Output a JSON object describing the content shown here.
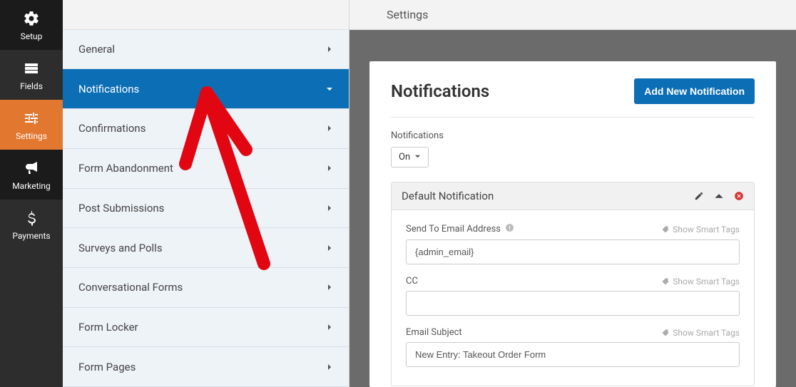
{
  "header": {
    "title": "Settings"
  },
  "nav": {
    "items": [
      {
        "label": "Setup",
        "icon": "gear-icon"
      },
      {
        "label": "Fields",
        "icon": "list-icon"
      },
      {
        "label": "Settings",
        "icon": "sliders-icon"
      },
      {
        "label": "Marketing",
        "icon": "bullhorn-icon"
      },
      {
        "label": "Payments",
        "icon": "dollar-icon"
      }
    ]
  },
  "subnav": {
    "items": [
      {
        "label": "General"
      },
      {
        "label": "Notifications"
      },
      {
        "label": "Confirmations"
      },
      {
        "label": "Form Abandonment"
      },
      {
        "label": "Post Submissions"
      },
      {
        "label": "Surveys and Polls"
      },
      {
        "label": "Conversational Forms"
      },
      {
        "label": "Form Locker"
      },
      {
        "label": "Form Pages"
      }
    ]
  },
  "main": {
    "title": "Notifications",
    "add_button": "Add New Notification",
    "toggle_label": "Notifications",
    "toggle_value": "On",
    "notification": {
      "title": "Default Notification",
      "fields": {
        "send_to": {
          "label": "Send To Email Address",
          "smart": "Show Smart Tags",
          "value": "{admin_email}"
        },
        "cc": {
          "label": "CC",
          "smart": "Show Smart Tags",
          "value": ""
        },
        "subject": {
          "label": "Email Subject",
          "smart": "Show Smart Tags",
          "value": "New Entry: Takeout Order Form"
        }
      }
    }
  }
}
